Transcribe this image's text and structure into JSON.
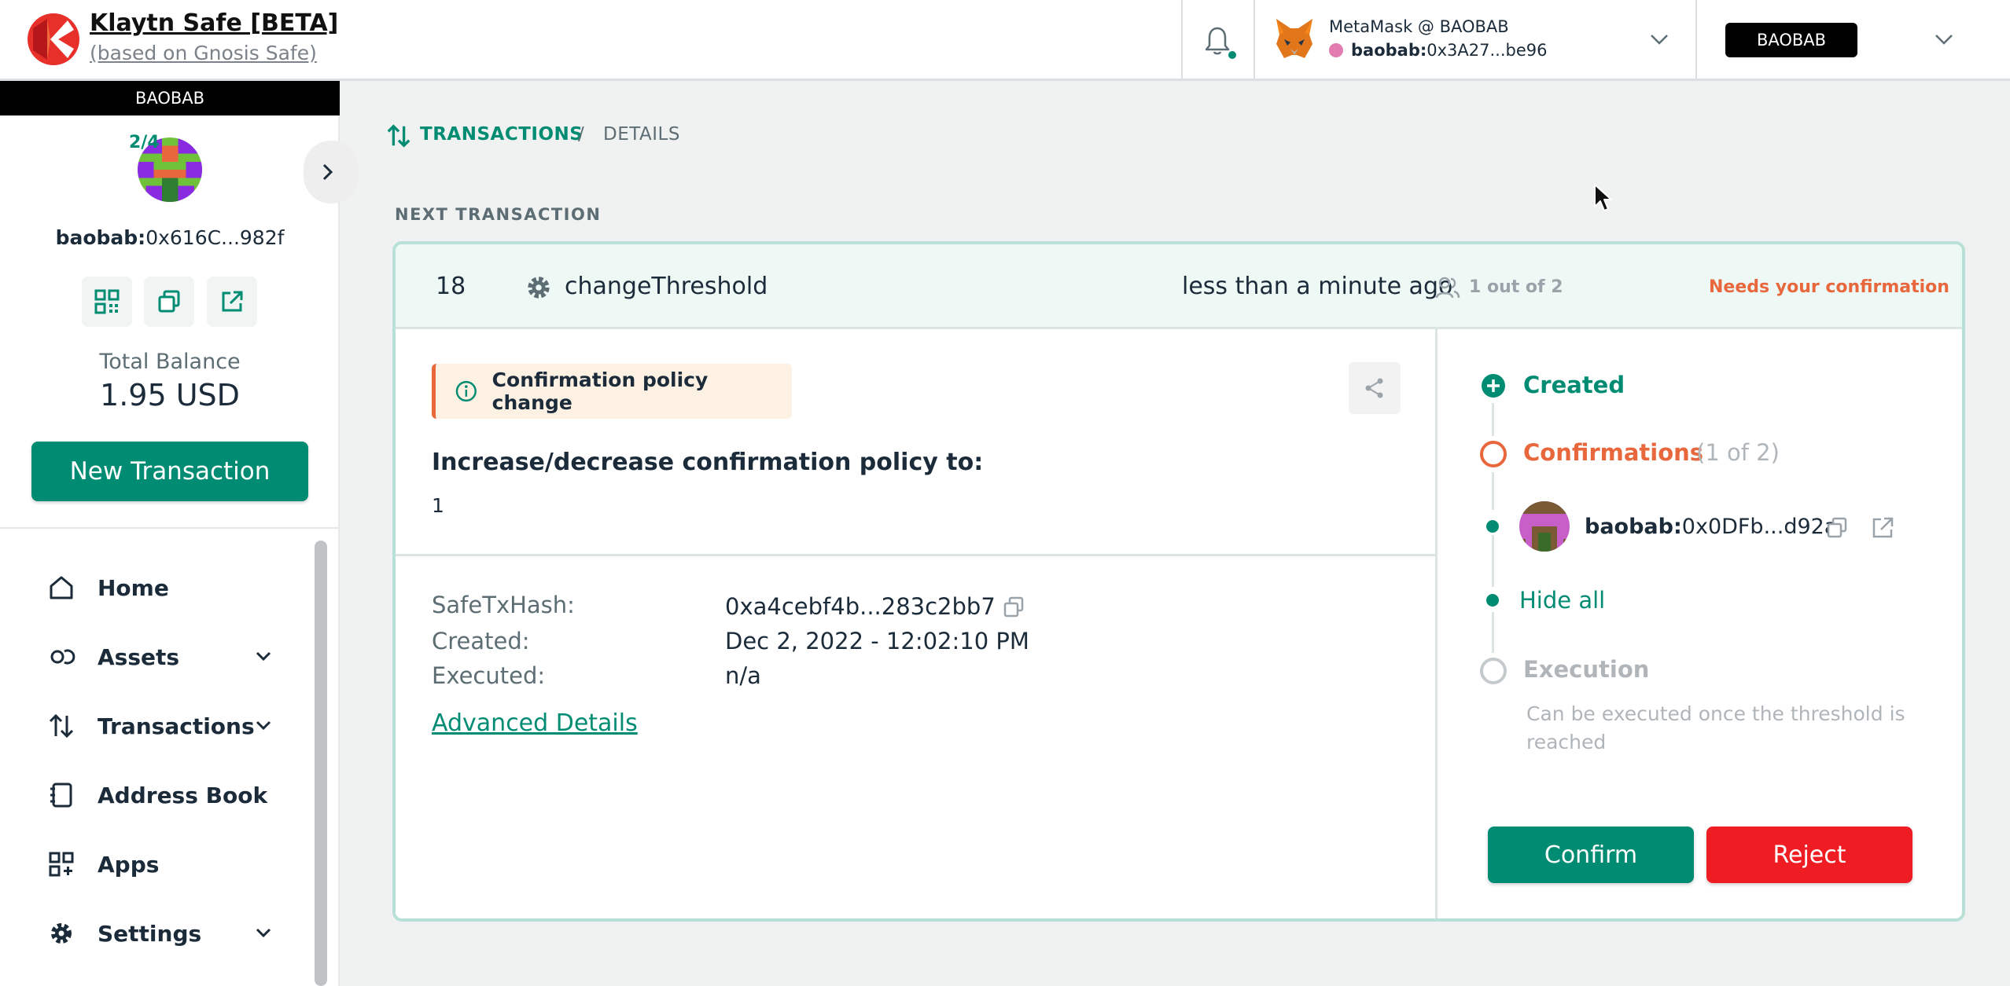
{
  "header": {
    "brand_title": "Klaytn Safe [BETA]",
    "brand_subtitle": "(based on Gnosis Safe)",
    "wallet_name": "MetaMask @ BAOBAB",
    "wallet_addr_prefix": "baobab:",
    "wallet_addr": "0x3A27...be96",
    "network": "BAOBAB"
  },
  "sidebar": {
    "network": "BAOBAB",
    "threshold": "2/4",
    "safe_addr_prefix": "baobab:",
    "safe_addr": "0x616C...982f",
    "total_balance_label": "Total Balance",
    "total_balance_value": "1.95 USD",
    "new_tx_label": "New Transaction",
    "nav": [
      {
        "label": "Home",
        "icon": "home-icon"
      },
      {
        "label": "Assets",
        "icon": "assets-icon"
      },
      {
        "label": "Transactions",
        "icon": "transactions-icon"
      },
      {
        "label": "Address Book",
        "icon": "address-book-icon"
      },
      {
        "label": "Apps",
        "icon": "apps-icon"
      },
      {
        "label": "Settings",
        "icon": "settings-icon"
      }
    ]
  },
  "breadcrumb": {
    "section": "TRANSACTIONS",
    "separator": "/",
    "page": "DETAILS"
  },
  "main": {
    "section_title": "NEXT TRANSACTION",
    "tx": {
      "nonce": "18",
      "method": "changeThreshold",
      "time": "less than a minute ago",
      "owners": "1 out of 2",
      "status": "Needs your confirmation"
    },
    "policy_chip": "Confirmation policy change",
    "policy_title": "Increase/decrease confirmation policy to:",
    "policy_value": "1",
    "details": {
      "hash_label": "SafeTxHash:",
      "hash_value": "0xa4cebf4b...283c2bb7",
      "created_label": "Created:",
      "created_value": "Dec 2, 2022 - 12:02:10 PM",
      "executed_label": "Executed:",
      "executed_value": "n/a",
      "advanced_link": "Advanced Details"
    },
    "timeline": {
      "created": "Created",
      "confirmations": "Confirmations",
      "confirmations_count": "(1 of 2)",
      "owner_prefix": "baobab:",
      "owner_addr": "0x0DFb...d92a",
      "hide_all": "Hide all",
      "execution": "Execution",
      "execution_note": "Can be executed once the threshold is reached"
    },
    "confirm_label": "Confirm",
    "reject_label": "Reject"
  },
  "colors": {
    "accent": "#008c73",
    "warning": "#e8673c",
    "danger": "#ef1c24",
    "network_bg": "#000000"
  }
}
